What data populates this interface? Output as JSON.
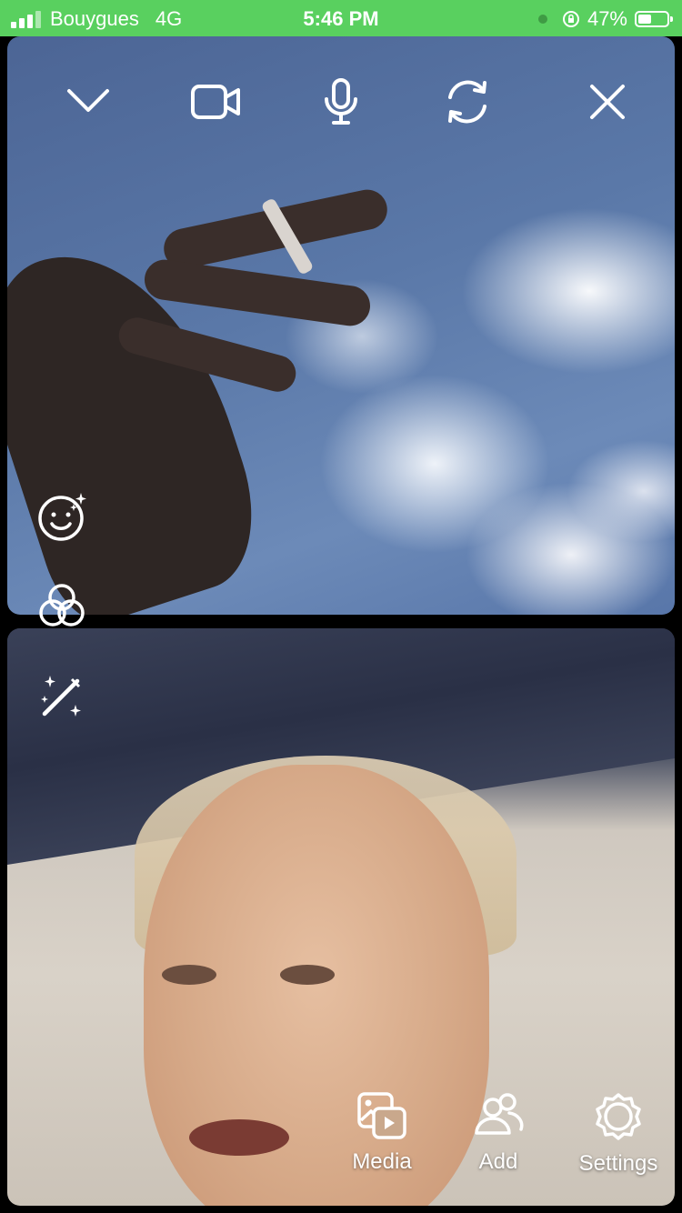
{
  "status_bar": {
    "carrier": "Bouygues",
    "network": "4G",
    "time": "5:46 PM",
    "battery": "47%",
    "battery_level": 0.47,
    "background": "#59d05f"
  },
  "top_controls": {
    "icons": [
      "chevron-down-icon",
      "video-camera-icon",
      "microphone-icon",
      "flip-camera-icon",
      "close-icon"
    ]
  },
  "side_tools": {
    "icons": [
      "face-effects-icon",
      "filters-icon",
      "magic-wand-icon"
    ]
  },
  "bottom_actions": {
    "media_label": "Media",
    "add_label": "Add",
    "settings_label": "Settings"
  }
}
